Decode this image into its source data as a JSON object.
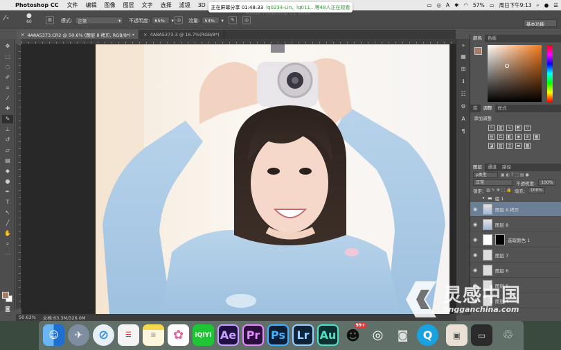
{
  "menubar": {
    "app_name": "Photoshop CC",
    "items": [
      "文件",
      "编辑",
      "图像",
      "图层",
      "文字",
      "选择",
      "滤镜",
      "3D"
    ],
    "right": {
      "percent": "57%",
      "clock": "周日下午9:13"
    },
    "share_banner": {
      "prefix": "正在屏幕分享 01:48:33",
      "highlight": "lq0234-Lin、lq011...等48人正在观看"
    }
  },
  "options_bar": {
    "window_title": "Adobe Photoshop CC 2018",
    "brush_size": "60",
    "mode_label": "模式:",
    "mode_value": "正常",
    "opacity_label": "不透明度:",
    "opacity_value": "65%",
    "flow_label": "流量:",
    "flow_value": "53%",
    "workspace": "基本功能"
  },
  "tabs": [
    {
      "label": "4A8A5373.CR2 @ 50.6% (图层 8 拷贝, RGB/8*) *",
      "active": true
    },
    {
      "label": "4A8A5373-3 @ 16.7%(RGB/8*)",
      "active": false
    }
  ],
  "status": {
    "zoom": "50.63%",
    "doc": "文档:63.3M/326.0M"
  },
  "color_panel": {
    "tabs": [
      "颜色",
      "色板"
    ],
    "fg_color": "#a47c68",
    "bg_color": "#ffffff"
  },
  "adjust_panel": {
    "tabs": [
      "库",
      "调整",
      "样式"
    ],
    "title": "添加调整"
  },
  "layers_panel": {
    "tabs": [
      "图层",
      "通道",
      "路径"
    ],
    "filter": "ρ类型",
    "blend": "正常",
    "opacity_label": "不透明度:",
    "opacity_value": "100%",
    "lock_label": "锁定:",
    "fill_label": "填充:",
    "fill_value": "100%",
    "layers": [
      {
        "name": "组 1",
        "kind": "group",
        "active": false
      },
      {
        "name": "图层 8 拷贝",
        "kind": "photo",
        "active": true
      },
      {
        "name": "图层 8",
        "kind": "photo",
        "active": false
      },
      {
        "name": "选取颜色 1",
        "kind": "adjust",
        "active": false
      },
      {
        "name": "图层 7",
        "kind": "plain",
        "active": false
      },
      {
        "name": "图层 6",
        "kind": "plain",
        "active": false
      },
      {
        "name": "图层 5",
        "kind": "plain",
        "active": false
      },
      {
        "name": "图层 4",
        "kind": "plain",
        "active": false
      }
    ]
  },
  "dock": {
    "apps": [
      {
        "name": "Finder",
        "label": "",
        "color": "#3d8ee0"
      },
      {
        "name": "Launchpad",
        "label": "",
        "color": "#8a96a6"
      },
      {
        "name": "Safari",
        "label": "",
        "color": "#2f8fe6"
      },
      {
        "name": "Reminders",
        "label": "",
        "color": "#f3f3f3"
      },
      {
        "name": "Notes",
        "label": "",
        "color": "#f6d84d"
      },
      {
        "name": "Photos",
        "label": "",
        "color": "#ffffff"
      },
      {
        "name": "iQIYI",
        "label": "iQIYI",
        "color": "#20c535"
      },
      {
        "name": "After Effects",
        "label": "Ae",
        "color": "#1f0f43"
      },
      {
        "name": "Premiere",
        "label": "Pr",
        "color": "#2a0f3d"
      },
      {
        "name": "Photoshop",
        "label": "Ps",
        "color": "#0a1e35"
      },
      {
        "name": "Lightroom",
        "label": "Lr",
        "color": "#0d2337"
      },
      {
        "name": "Audition",
        "label": "Au",
        "color": "#0b3030"
      },
      {
        "name": "QQ",
        "label": "",
        "color": "#e9e9e9"
      },
      {
        "name": "WeChat",
        "label": "",
        "color": "#ffffff"
      }
    ],
    "qq_badge": "99+"
  },
  "watermark": {
    "text": "灵感中国",
    "url": "lingganchina.com"
  }
}
